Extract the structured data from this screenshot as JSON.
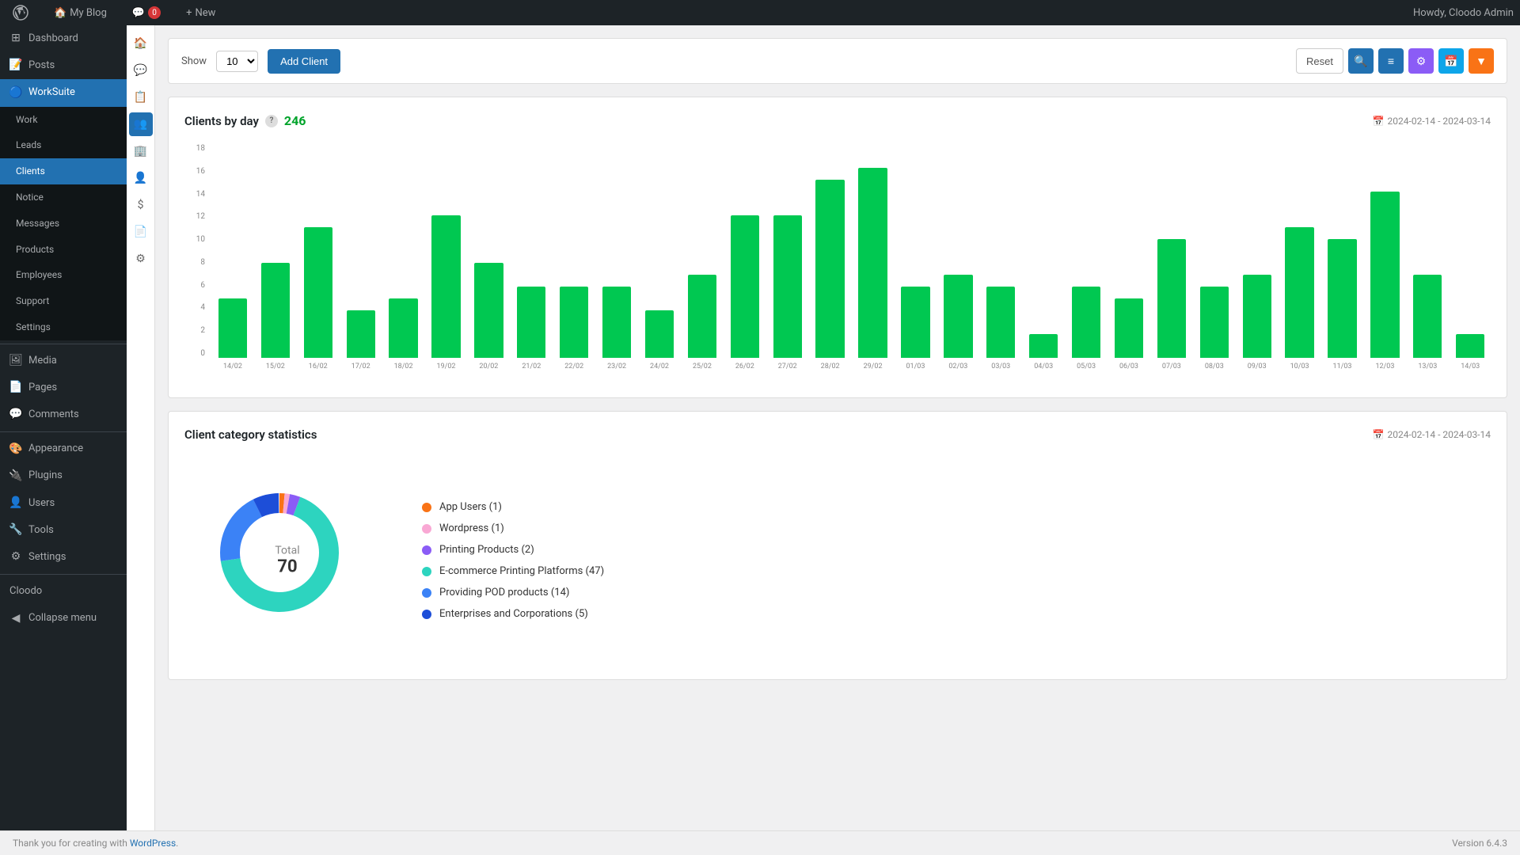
{
  "adminBar": {
    "siteName": "My Blog",
    "notifications": "0",
    "newLabel": "New",
    "userGreeting": "Howdy, Cloodo Admin"
  },
  "sidebar": {
    "dashboard": "Dashboard",
    "posts": "Posts",
    "worksuite": "WorkSuite",
    "worksuite_label": "WorkSuite",
    "work": "Work",
    "leads": "Leads",
    "clients": "Clients",
    "notice": "Notice",
    "messages": "Messages",
    "products": "Products",
    "employees": "Employees",
    "support": "Support",
    "settings": "Settings",
    "media": "Media",
    "pages": "Pages",
    "comments": "Comments",
    "appearance": "Appearance",
    "plugins": "Plugins",
    "users": "Users",
    "tools": "Tools",
    "settings2": "Settings",
    "cloodo": "Cloodo",
    "collapse": "Collapse menu"
  },
  "toolbar": {
    "show_label": "Show",
    "show_value": "10",
    "add_client": "Add Client",
    "reset": "Reset"
  },
  "clientsByDay": {
    "title": "Clients by day",
    "count": "246",
    "dateRange": "2024-02-14 - 2024-03-14",
    "yLabels": [
      "18",
      "16",
      "14",
      "12",
      "10",
      "8",
      "6",
      "4",
      "2",
      "0"
    ],
    "bars": [
      {
        "date": "14/02",
        "value": 5
      },
      {
        "date": "15/02",
        "value": 8
      },
      {
        "date": "16/02",
        "value": 11
      },
      {
        "date": "17/02",
        "value": 4
      },
      {
        "date": "18/02",
        "value": 5
      },
      {
        "date": "19/02",
        "value": 12
      },
      {
        "date": "20/02",
        "value": 8
      },
      {
        "date": "21/02",
        "value": 6
      },
      {
        "date": "22/02",
        "value": 6
      },
      {
        "date": "23/02",
        "value": 6
      },
      {
        "date": "24/02",
        "value": 4
      },
      {
        "date": "25/02",
        "value": 7
      },
      {
        "date": "26/02",
        "value": 12
      },
      {
        "date": "27/02",
        "value": 12
      },
      {
        "date": "28/02",
        "value": 15
      },
      {
        "date": "29/02",
        "value": 16
      },
      {
        "date": "01/03",
        "value": 6
      },
      {
        "date": "02/03",
        "value": 7
      },
      {
        "date": "03/03",
        "value": 6
      },
      {
        "date": "04/03",
        "value": 2
      },
      {
        "date": "05/03",
        "value": 6
      },
      {
        "date": "06/03",
        "value": 5
      },
      {
        "date": "07/03",
        "value": 10
      },
      {
        "date": "08/03",
        "value": 6
      },
      {
        "date": "09/03",
        "value": 7
      },
      {
        "date": "10/03",
        "value": 11
      },
      {
        "date": "11/03",
        "value": 10
      },
      {
        "date": "12/03",
        "value": 14
      },
      {
        "date": "13/03",
        "value": 7
      },
      {
        "date": "14/03",
        "value": 2
      }
    ]
  },
  "categoryStats": {
    "title": "Client category statistics",
    "dateRange": "2024-02-14 - 2024-03-14",
    "total_label": "Total",
    "total_value": "70",
    "segments": [
      {
        "label": "App Users (1)",
        "color": "#f97316",
        "percent": 1.4,
        "legend": "App Users (1)"
      },
      {
        "label": "Wordpress (1)",
        "color": "#f9a8d4",
        "percent": 1.4,
        "legend": "Wordpress (1)"
      },
      {
        "label": "Printing Products (2)",
        "color": "#8b5cf6",
        "percent": 2.9,
        "legend": "Printing Products (2)"
      },
      {
        "label": "E-commerce Printing Platforms (47)",
        "color": "#2dd4bf",
        "percent": 67,
        "legend": "E-commerce Printing Platforms (47)"
      },
      {
        "label": "Providing POD products (14)",
        "color": "#3b82f6",
        "percent": 20,
        "legend": "Providing POD products (14)"
      },
      {
        "label": "Enterprises and Corporations (5)",
        "color": "#1d4ed8",
        "percent": 7.1,
        "legend": "Enterprises and Corporations (5)"
      }
    ]
  },
  "footer": {
    "thank_you": "Thank you for creating with ",
    "wp_link": "WordPress",
    "version": "Version 6.4.3"
  }
}
